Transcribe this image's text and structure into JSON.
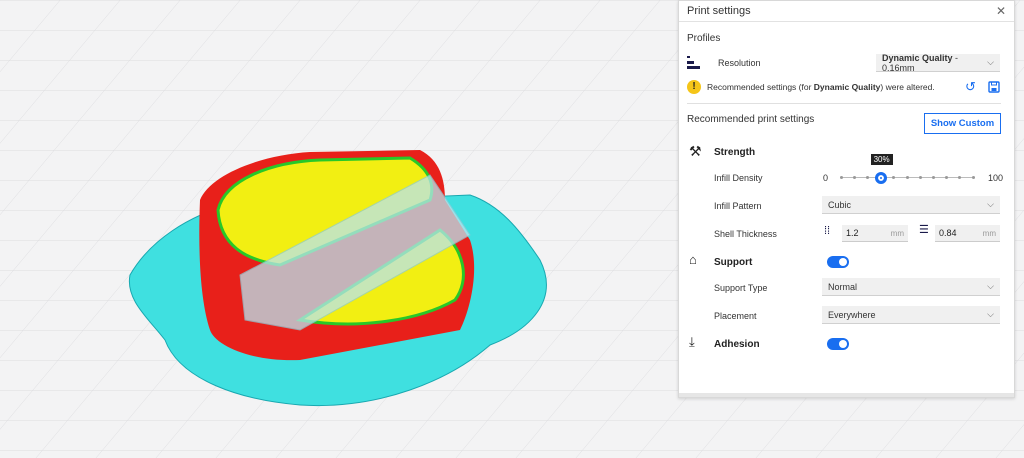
{
  "panel": {
    "title": "Print settings",
    "close_icon": "close-icon"
  },
  "profiles": {
    "heading": "Profiles",
    "resolution_label": "Resolution",
    "resolution_value_bold": "Dynamic Quality",
    "resolution_value_rest": " - 0.16mm",
    "warning_pre": "Recommended settings (for ",
    "warning_bold": "Dynamic Quality",
    "warning_post": ") were altered."
  },
  "recommended": {
    "heading": "Recommended print settings",
    "show_custom": "Show Custom"
  },
  "strength": {
    "label": "Strength",
    "infill_density_label": "Infill Density",
    "slider_min": "0",
    "slider_max": "100",
    "infill_density_value": 30,
    "infill_density_tooltip": "30%",
    "infill_pattern_label": "Infill Pattern",
    "infill_pattern_value": "Cubic",
    "shell_thickness_label": "Shell Thickness",
    "wall_value": "1.2",
    "top_bottom_value": "0.84",
    "unit": "mm"
  },
  "support": {
    "label": "Support",
    "enabled": true,
    "type_label": "Support Type",
    "type_value": "Normal",
    "placement_label": "Placement",
    "placement_value": "Everywhere"
  },
  "adhesion": {
    "label": "Adhesion",
    "enabled": true
  },
  "colors": {
    "accent": "#196ef0",
    "warning": "#f5c518",
    "model_wall": "#e8201a",
    "model_infill": "#f2ef12",
    "model_skirt": "#3fe0e0",
    "model_inner_wall": "#28c828"
  }
}
